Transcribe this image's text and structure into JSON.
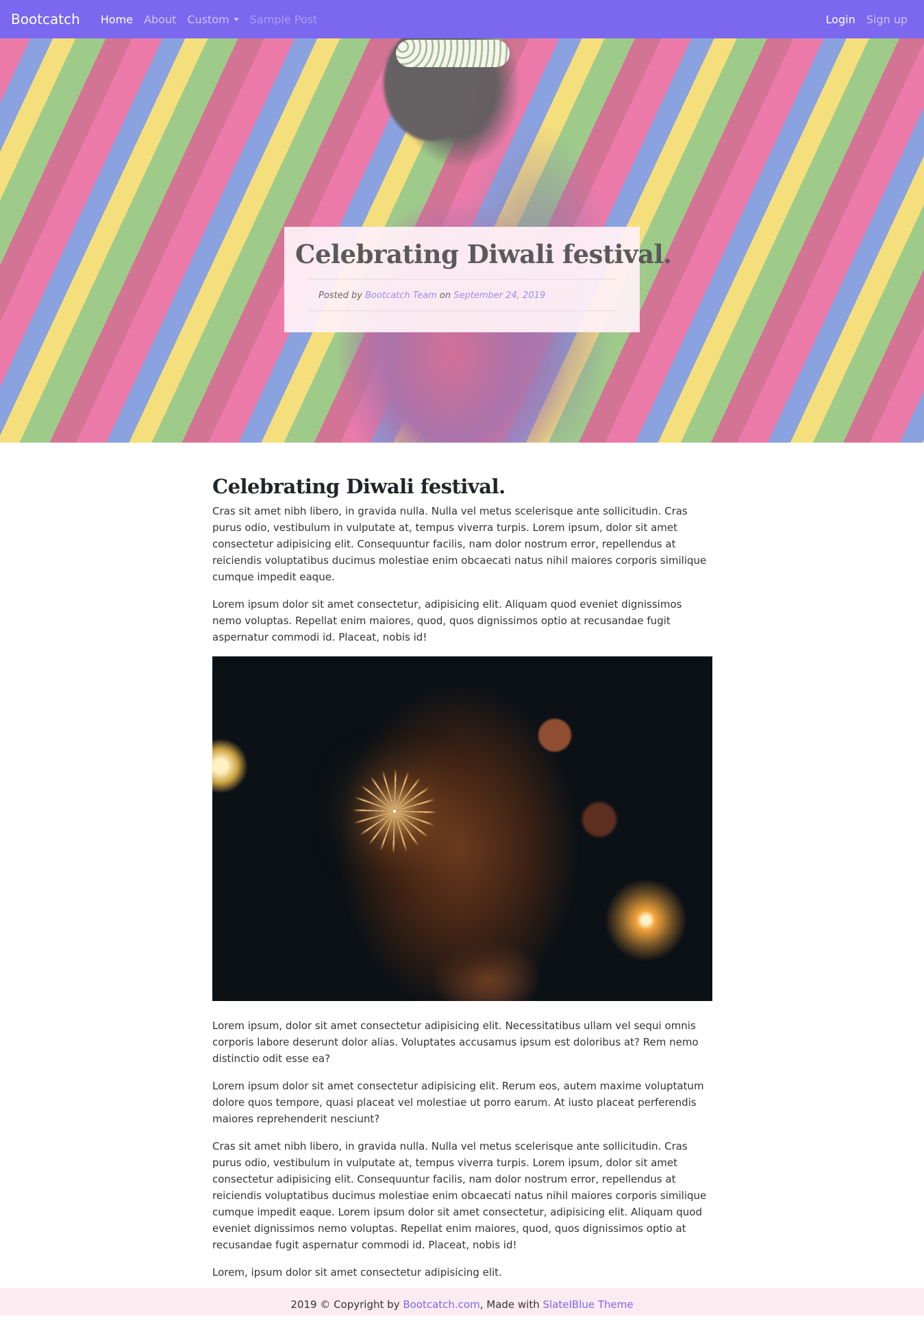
{
  "navbar": {
    "brand": "Bootcatch",
    "links": [
      {
        "label": "Home"
      },
      {
        "label": "About"
      },
      {
        "label": "Custom"
      },
      {
        "label": "Sample Post"
      }
    ],
    "right_links": [
      {
        "label": "Login"
      },
      {
        "label": "Sign up"
      }
    ],
    "background_color": "#7b68ee"
  },
  "hero": {
    "title": "Celebrating Diwali festival.",
    "posted_by_prefix": "Posted by",
    "author": "Bootcatch Team",
    "on_word": "on",
    "date": "September 24, 2019"
  },
  "post": {
    "title": "Celebrating Diwali festival.",
    "paragraphs": [
      "Cras sit amet nibh libero, in gravida nulla. Nulla vel metus scelerisque ante sollicitudin. Cras purus odio, vestibulum in vulputate at, tempus viverra turpis. Lorem ipsum, dolor sit amet consectetur adipisicing elit. Consequuntur facilis, nam dolor nostrum error, repellendus at reiciendis voluptatibus ducimus molestiae enim obcaecati natus nihil maiores corporis similique cumque impedit eaque.",
      "Lorem ipsum dolor sit amet consectetur, adipisicing elit. Aliquam quod eveniet dignissimos nemo voluptas. Repellat enim maiores, quod, quos dignissimos optio at recusandae fugit aspernatur commodi id. Placeat, nobis id!",
      "Lorem ipsum, dolor sit amet consectetur adipisicing elit. Necessitatibus ullam vel sequi omnis corporis labore deserunt dolor alias. Voluptates accusamus ipsum est doloribus at? Rem nemo distinctio odit esse ea?",
      "Lorem ipsum dolor sit amet consectetur adipisicing elit. Rerum eos, autem maxime voluptatum dolore quos tempore, quasi placeat vel molestiae ut porro earum. At iusto placeat perferendis maiores reprehenderit nesciunt?",
      "Cras sit amet nibh libero, in gravida nulla. Nulla vel metus scelerisque ante sollicitudin. Cras purus odio, vestibulum in vulputate at, tempus viverra turpis. Lorem ipsum, dolor sit amet consectetur adipisicing elit. Consequuntur facilis, nam dolor nostrum error, repellendus at reiciendis voluptatibus ducimus molestiae enim obcaecati natus nihil maiores corporis similique cumque impedit eaque. Lorem ipsum dolor sit amet consectetur, adipisicing elit. Aliquam quod eveniet dignissimos nemo voluptas. Repellat enim maiores, quod, quos dignissimos optio at recusandae fugit aspernatur commodi id. Placeat, nobis id!",
      "Lorem, ipsum dolor sit amet consectetur adipisicing elit."
    ]
  },
  "footer": {
    "prefix": "2019 © Copyright by",
    "site_link": "Bootcatch.com",
    "middle": ", Made with",
    "theme_link": "SlateIBlue Theme",
    "link_color": "#7b68ee"
  }
}
